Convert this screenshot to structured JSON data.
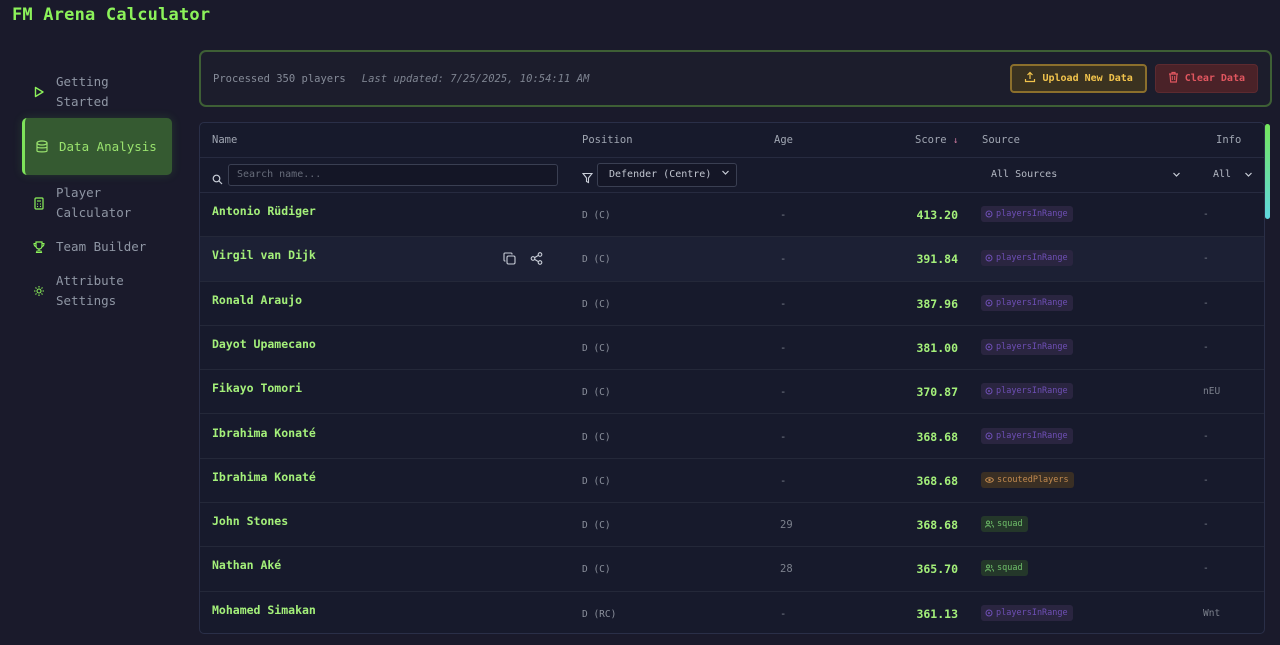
{
  "app_title": "FM Arena Calculator",
  "sidebar": {
    "items": [
      {
        "label": "Getting Started",
        "icon": "play-icon",
        "active": false
      },
      {
        "label": "Data Analysis",
        "icon": "database-icon",
        "active": true
      },
      {
        "label": "Player Calculator",
        "icon": "calculator-icon",
        "active": false
      },
      {
        "label": "Team Builder",
        "icon": "trophy-icon",
        "active": false
      },
      {
        "label": "Attribute Settings",
        "icon": "gear-icon",
        "active": false
      }
    ]
  },
  "status": {
    "processed": "Processed 350 players",
    "updated": "Last updated: 7/25/2025, 10:54:11 AM"
  },
  "buttons": {
    "upload": "Upload New Data",
    "clear": "Clear Data"
  },
  "table": {
    "headers": {
      "name": "Name",
      "position": "Position",
      "age": "Age",
      "score": "Score",
      "source": "Source",
      "info": "Info"
    },
    "sort_indicator": "↓",
    "filters": {
      "search_placeholder": "Search name...",
      "position_selected": "Defender (Centre)",
      "source_selected": "All Sources",
      "info_selected": "All"
    },
    "rows": [
      {
        "name": "Antonio Rüdiger",
        "position": "D (C)",
        "age": "-",
        "score": "413.20",
        "source": "playersInRange",
        "source_type": "range",
        "info": "-"
      },
      {
        "name": "Virgil van Dijk",
        "position": "D (C)",
        "age": "-",
        "score": "391.84",
        "source": "playersInRange",
        "source_type": "range",
        "info": "-"
      },
      {
        "name": "Ronald Araujo",
        "position": "D (C)",
        "age": "-",
        "score": "387.96",
        "source": "playersInRange",
        "source_type": "range",
        "info": "-"
      },
      {
        "name": "Dayot Upamecano",
        "position": "D (C)",
        "age": "-",
        "score": "381.00",
        "source": "playersInRange",
        "source_type": "range",
        "info": "-"
      },
      {
        "name": "Fikayo Tomori",
        "position": "D (C)",
        "age": "-",
        "score": "370.87",
        "source": "playersInRange",
        "source_type": "range",
        "info": "nEU"
      },
      {
        "name": "Ibrahima Konaté",
        "position": "D (C)",
        "age": "-",
        "score": "368.68",
        "source": "playersInRange",
        "source_type": "range",
        "info": "-"
      },
      {
        "name": "Ibrahima Konaté",
        "position": "D (C)",
        "age": "-",
        "score": "368.68",
        "source": "scoutedPlayers",
        "source_type": "scouted",
        "info": "-"
      },
      {
        "name": "John Stones",
        "position": "D (C)",
        "age": "29",
        "score": "368.68",
        "source": "squad",
        "source_type": "squad",
        "info": "-"
      },
      {
        "name": "Nathan Aké",
        "position": "D (C)",
        "age": "28",
        "score": "365.70",
        "source": "squad",
        "source_type": "squad",
        "info": "-"
      },
      {
        "name": "Mohamed Simakan",
        "position": "D (RC)",
        "age": "-",
        "score": "361.13",
        "source": "playersInRange",
        "source_type": "range",
        "info": "Wnt"
      }
    ]
  },
  "colors": {
    "accent_green": "#8cf25a",
    "upload_yellow": "#f1c34c",
    "clear_red": "#e0565f",
    "range_purple": "#6e4fb5",
    "scouted_orange": "#c28a4f",
    "squad_green": "#6fbf6a"
  }
}
